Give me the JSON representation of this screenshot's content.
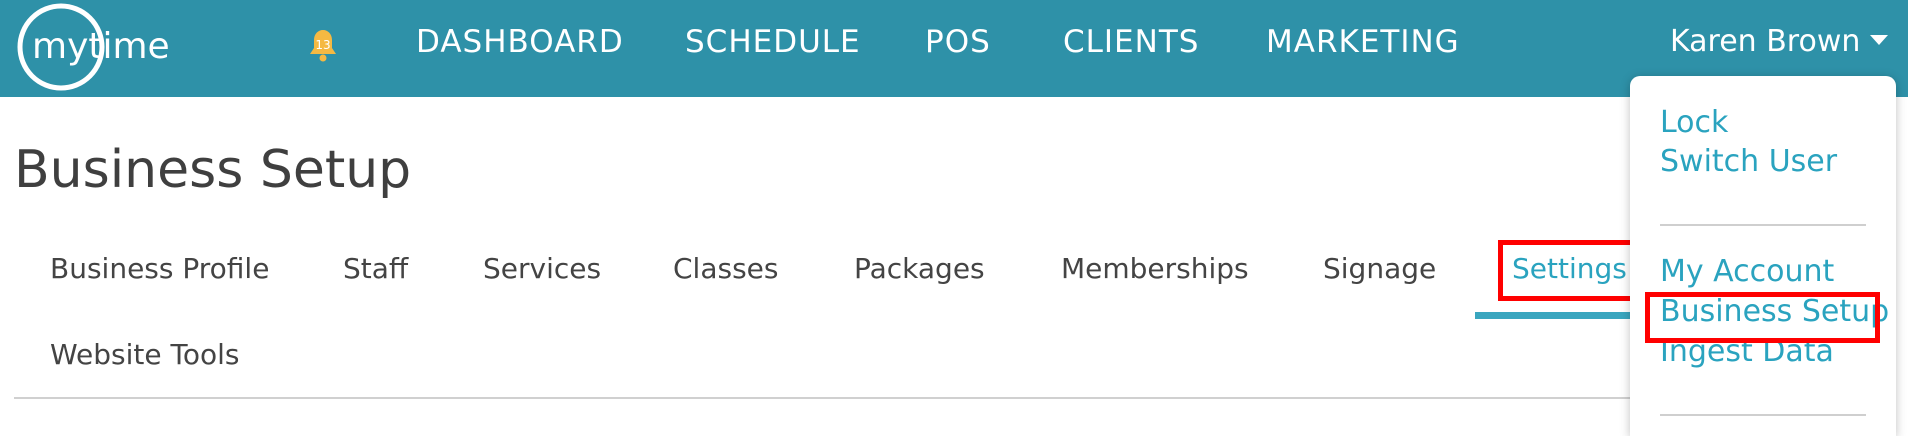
{
  "header": {
    "logo_text": "mytime",
    "notification_count": "13",
    "nav": [
      "DASHBOARD",
      "SCHEDULE",
      "POS",
      "CLIENTS",
      "MARKETING"
    ],
    "user_name": "Karen Brown"
  },
  "page": {
    "title": "Business Setup"
  },
  "tabs": [
    "Business Profile",
    "Staff",
    "Services",
    "Classes",
    "Packages",
    "Memberships",
    "Signage",
    "Settings",
    "Website Tools"
  ],
  "active_tab": "Settings",
  "dropdown": {
    "group1": [
      "Lock",
      "Switch User"
    ],
    "group2": [
      "My Account",
      "Business Setup",
      "Ingest Data"
    ]
  },
  "colors": {
    "header_bg": "#2e91a8",
    "accent": "#2aa3bf",
    "highlight": "#ff0000"
  }
}
